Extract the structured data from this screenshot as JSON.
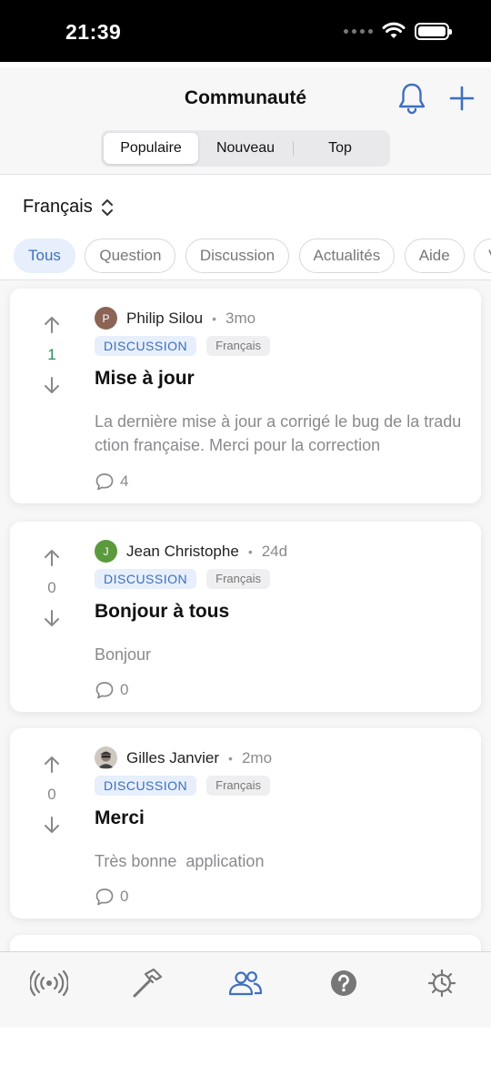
{
  "status_bar": {
    "time": "21:39"
  },
  "header": {
    "title": "Communauté",
    "segments": [
      "Populaire",
      "Nouveau",
      "Top"
    ],
    "active_segment": "Populaire"
  },
  "language_selector": {
    "value": "Français"
  },
  "filters": {
    "items": [
      "Tous",
      "Question",
      "Discussion",
      "Actualités",
      "Aide",
      "Vi"
    ],
    "active": "Tous"
  },
  "posts": [
    {
      "author": "Philip Silou",
      "avatar_initial": "P",
      "avatar_color": "#8b6456",
      "time": "3mo",
      "type": "DISCUSSION",
      "language": "Français",
      "title": "Mise à jour",
      "body": "La dernière mise à jour a corrigé le bug de la traduction française. Merci pour la correction",
      "votes": "1",
      "comments": "4"
    },
    {
      "author": "Jean Christophe",
      "avatar_initial": "J",
      "avatar_color": "#5a9a3c",
      "time": "24d",
      "type": "DISCUSSION",
      "language": "Français",
      "title": "Bonjour à tous",
      "body": "Bonjour",
      "votes": "0",
      "comments": "0"
    },
    {
      "author": "Gilles Janvier",
      "avatar_initial": "",
      "avatar_color": "#6b6b6b",
      "time": "2mo",
      "type": "DISCUSSION",
      "language": "Français",
      "title": "Merci",
      "body": "Très bonne  application",
      "votes": "0",
      "comments": "0"
    }
  ],
  "tab_bar": {
    "items": [
      "broadcast-icon",
      "hammer-icon",
      "community-icon",
      "help-icon",
      "settings-icon"
    ],
    "active": "community-icon"
  },
  "colors": {
    "accent": "#3f6fbe",
    "positive_vote": "#2e8b57",
    "text_secondary": "#8a8a8e"
  }
}
